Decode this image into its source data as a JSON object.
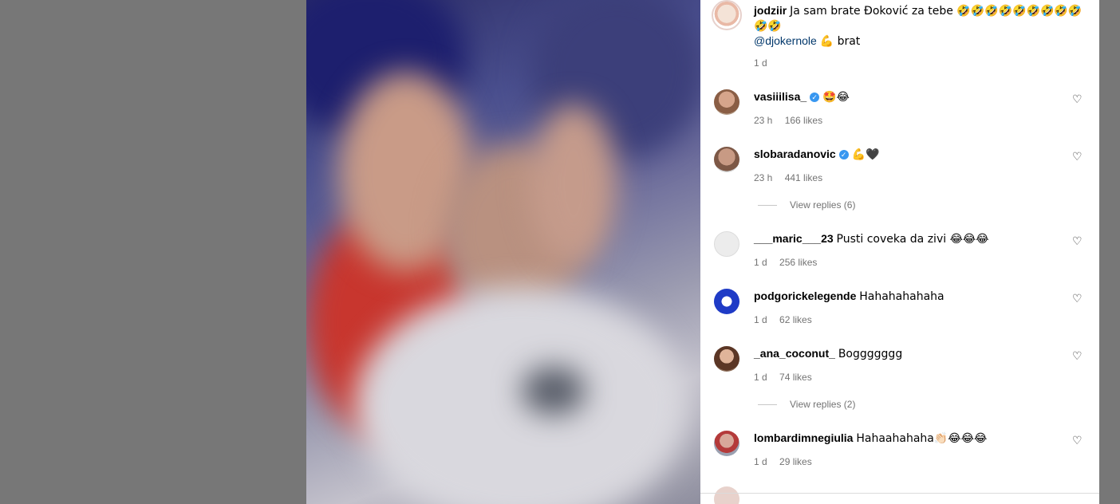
{
  "post": {
    "caption": {
      "username": "jodziir",
      "text": "Ja sam brate Đoković za tebe 🤣🤣🤣🤣🤣🤣🤣🤣🤣🤣🤣",
      "mention": "@djokernole",
      "text2": "💪 brat",
      "time": "1 d"
    },
    "comments": [
      {
        "username": "vasiiilisa_",
        "verified": true,
        "text": "🤩😂",
        "time": "23 h",
        "likes": "166 likes"
      },
      {
        "username": "slobaradanovic",
        "verified": true,
        "text": "💪🖤",
        "time": "23 h",
        "likes": "441 likes",
        "replies": "View replies (6)"
      },
      {
        "username": "___maric___23",
        "verified": false,
        "text": "Pusti coveka da zivi 😂😂😂",
        "time": "1 d",
        "likes": "256 likes"
      },
      {
        "username": "podgorickelegende",
        "verified": false,
        "text": "Hahahahahaha",
        "time": "1 d",
        "likes": "62 likes"
      },
      {
        "username": "_ana_coconut_",
        "verified": false,
        "text": "Boggggggg",
        "time": "1 d",
        "likes": "74 likes",
        "replies": "View replies (2)"
      },
      {
        "username": "lombardimnegiulia",
        "verified": false,
        "text": "Hahaahahaha👏🏻😂😂😂",
        "time": "1 d",
        "likes": "29 likes"
      }
    ]
  },
  "icons": {
    "like": "heart-icon",
    "verified": "verified-badge-icon"
  }
}
